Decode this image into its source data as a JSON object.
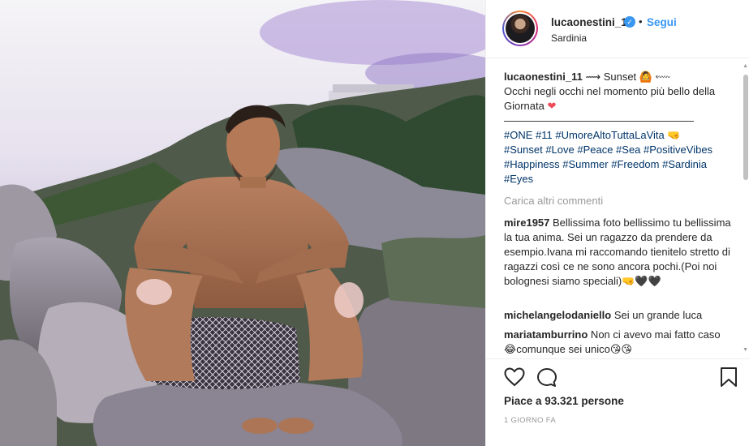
{
  "post": {
    "username": "lucaonestini_11",
    "follow_label": "Segui",
    "dot": "•",
    "location": "Sardinia",
    "verified_mark": "✓"
  },
  "caption": {
    "username": "lucaonestini_11",
    "line1": " ⟿ Sunset 🙆 ⬳",
    "line2": "Occhi negli occhi nel momento più bello della Giornata",
    "heart": "❤",
    "divider": "——————————————————",
    "tags_line1": "#ONE #11 #UmoreAltoTuttaLaVita 🤜",
    "tags_line2": "#Sunset #Love #Peace #Sea #PositiveVibes",
    "tags_line3": "#Happiness #Summer #Freedom #Sardinia",
    "tags_line4": "#Eyes"
  },
  "load_more": "Carica altri commenti",
  "comments": [
    {
      "username": "mire1957",
      "text": " Bellissima foto bellissimo tu bellissima la tua anima. Sei un ragazzo da prendere da esempio.Ivana mi raccomando tienitelo stretto di ragazzi così ce ne sono ancora pochi.(Poi noi bolognesi siamo speciali)🤜🖤🖤"
    },
    {
      "username": "michelangelodaniello",
      "text": " Sei un grande luca"
    },
    {
      "username": "mariatamburrino",
      "text": " Non ci avevo mai fatto caso 😂comunque sei unico😘😘"
    }
  ],
  "actions": {
    "likes_text": "Piace a 93.321 persone",
    "timestamp": "1 GIORNO FA"
  },
  "icons": [
    "heart-icon",
    "comment-icon",
    "bookmark-icon",
    "verified-badge-icon"
  ],
  "colors": {
    "link_blue": "#3897f0",
    "hashtag_blue": "#003569",
    "muted": "#999999",
    "text": "#262626"
  }
}
